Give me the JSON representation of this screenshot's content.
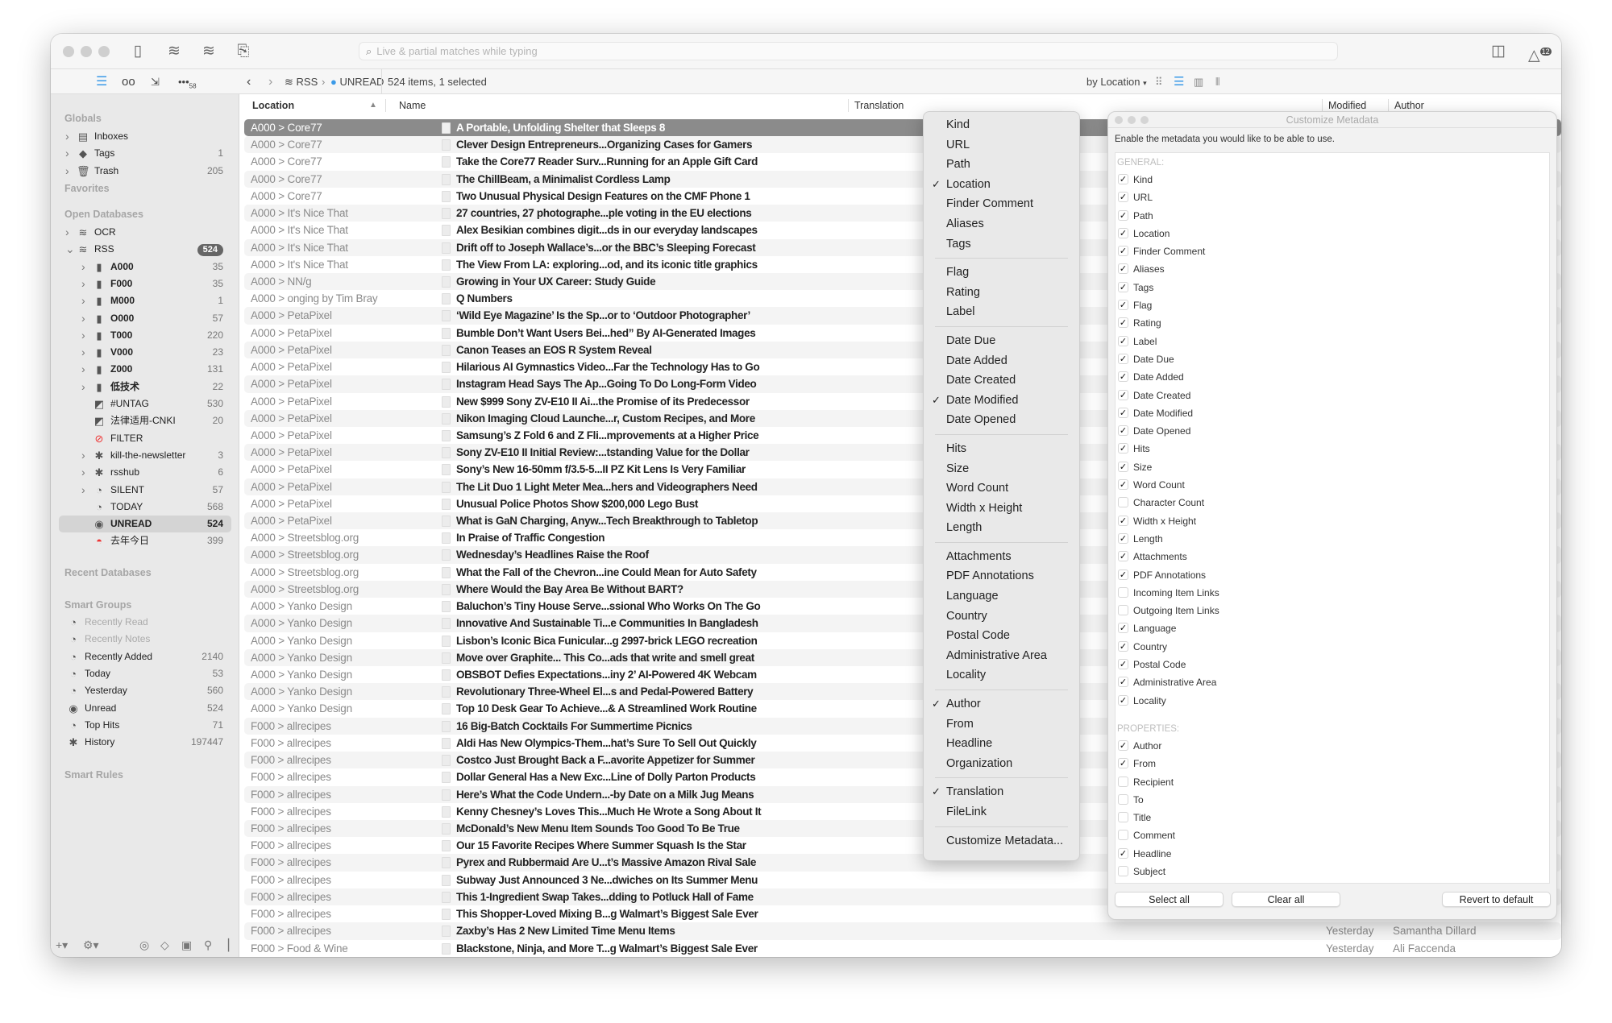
{
  "toolbar": {
    "search_placeholder": "Live & partial matches while typing",
    "notification_count": "12",
    "icons": [
      "sidebar-toggle-icon",
      "database-sync-icon",
      "database-verify-icon",
      "capture-icon",
      "inspector-toggle-icon",
      "activity-icon"
    ]
  },
  "navbar": {
    "sidebar_badge": "58",
    "crumbs": [
      "RSS",
      "UNREAD"
    ],
    "status": "524 items, 1 selected",
    "sort": "by Location",
    "accent": "#3a9ae8"
  },
  "sidebar": {
    "globals_label": "Globals",
    "globals": [
      {
        "label": "Inboxes",
        "count": "",
        "icon": "inbox-icon"
      },
      {
        "label": "Tags",
        "count": "1",
        "icon": "tag-icon"
      },
      {
        "label": "Trash",
        "count": "205",
        "icon": "trash-icon"
      }
    ],
    "favorites_label": "Favorites",
    "open_db_label": "Open Databases",
    "databases": [
      {
        "label": "OCR",
        "count": "",
        "icon": "database-icon",
        "chev": ">",
        "level": 0
      },
      {
        "label": "RSS",
        "count": "524",
        "icon": "database-icon",
        "chev": "v",
        "level": 0,
        "badge": true
      },
      {
        "label": "A000",
        "count": "35",
        "icon": "group-icon",
        "chev": ">",
        "level": 1,
        "bold": true
      },
      {
        "label": "F000",
        "count": "35",
        "icon": "group-icon",
        "chev": ">",
        "level": 1,
        "bold": true
      },
      {
        "label": "M000",
        "count": "1",
        "icon": "group-icon",
        "chev": ">",
        "level": 1,
        "bold": true
      },
      {
        "label": "O000",
        "count": "57",
        "icon": "group-icon",
        "chev": ">",
        "level": 1,
        "bold": true
      },
      {
        "label": "T000",
        "count": "220",
        "icon": "group-icon",
        "chev": ">",
        "level": 1,
        "bold": true
      },
      {
        "label": "V000",
        "count": "23",
        "icon": "group-icon",
        "chev": ">",
        "level": 1,
        "bold": true
      },
      {
        "label": "Z000",
        "count": "131",
        "icon": "group-icon",
        "chev": ">",
        "level": 1,
        "bold": true
      },
      {
        "label": "低技术",
        "count": "22",
        "icon": "group-icon",
        "chev": ">",
        "level": 1,
        "bold": true
      },
      {
        "label": "#UNTAG",
        "count": "530",
        "icon": "rss-feed-icon",
        "chev": "",
        "level": 1
      },
      {
        "label": "法律适用-CNKI",
        "count": "20",
        "icon": "rss-feed-icon",
        "chev": "",
        "level": 1
      },
      {
        "label": "FILTER",
        "count": "",
        "icon": "no-entry-icon",
        "chev": "",
        "level": 1
      },
      {
        "label": "kill-the-newsletter",
        "count": "3",
        "icon": "gear-icon",
        "chev": ">",
        "level": 1
      },
      {
        "label": "rsshub",
        "count": "6",
        "icon": "gear-icon",
        "chev": ">",
        "level": 1
      },
      {
        "label": "SILENT",
        "count": "57",
        "icon": "clock-icon",
        "chev": ">",
        "level": 1
      },
      {
        "label": "TODAY",
        "count": "568",
        "icon": "clock-icon",
        "chev": "",
        "level": 1
      },
      {
        "label": "UNREAD",
        "count": "524",
        "icon": "unread-icon",
        "chev": "",
        "level": 1,
        "selected": true
      },
      {
        "label": "去年今日",
        "count": "399",
        "icon": "sunset-icon",
        "chev": "",
        "level": 1
      }
    ],
    "recent_db_label": "Recent Databases",
    "smart_groups_label": "Smart Groups",
    "smart_groups": [
      {
        "label": "Recently Read",
        "count": "",
        "icon": "clock-icon",
        "dim": true
      },
      {
        "label": "Recently Notes",
        "count": "",
        "icon": "clock-icon",
        "dim": true
      },
      {
        "label": "Recently Added",
        "count": "2140",
        "icon": "clock-icon"
      },
      {
        "label": "Today",
        "count": "53",
        "icon": "clock-icon"
      },
      {
        "label": "Yesterday",
        "count": "560",
        "icon": "clock-icon"
      },
      {
        "label": "Unread",
        "count": "524",
        "icon": "unread-icon"
      },
      {
        "label": "Top Hits",
        "count": "71",
        "icon": "clock-icon"
      },
      {
        "label": "History",
        "count": "197447",
        "icon": "gear-icon"
      }
    ],
    "smart_rules_label": "Smart Rules"
  },
  "list": {
    "columns": {
      "location": "Location",
      "name": "Name",
      "translation": "Translation",
      "modified": "Modified",
      "author": "Author"
    },
    "rows": [
      {
        "loc": "A000 > Core77",
        "name": "A Portable, Unfolding Shelter that Sleeps 8",
        "selected": true
      },
      {
        "loc": "A000 > Core77",
        "name": "Clever Design Entrepreneurs...Organizing Cases for Gamers"
      },
      {
        "loc": "A000 > Core77",
        "name": "Take the Core77 Reader Surv...Running for an Apple Gift Card"
      },
      {
        "loc": "A000 > Core77",
        "name": "The ChillBeam, a Minimalist Cordless Lamp"
      },
      {
        "loc": "A000 > Core77",
        "name": "Two Unusual Physical Design Features on the CMF Phone 1"
      },
      {
        "loc": "A000 > It's Nice That",
        "name": "27 countries, 27 photographe...ple voting in the EU elections"
      },
      {
        "loc": "A000 > It's Nice That",
        "name": "Alex Besikian combines digit...ds in our everyday landscapes"
      },
      {
        "loc": "A000 > It's Nice That",
        "name": "Drift off to Joseph Wallace’s...or the BBC’s Sleeping Forecast"
      },
      {
        "loc": "A000 > It's Nice That",
        "name": "The View From LA: exploring...od, and its iconic title graphics"
      },
      {
        "loc": "A000 > NN/g",
        "name": "Growing in Your UX Career: Study Guide"
      },
      {
        "loc": "A000 > onging by Tim Bray",
        "name": "Q Numbers"
      },
      {
        "loc": "A000 > PetaPixel",
        "name": "‘Wild Eye Magazine’ Is the Sp...or to ‘Outdoor Photographer’"
      },
      {
        "loc": "A000 > PetaPixel",
        "name": "Bumble Don’t Want Users Bei...hed” By AI-Generated Images"
      },
      {
        "loc": "A000 > PetaPixel",
        "name": "Canon Teases an EOS R System Reveal"
      },
      {
        "loc": "A000 > PetaPixel",
        "name": "Hilarious AI Gymnastics Video...Far the Technology Has to Go"
      },
      {
        "loc": "A000 > PetaPixel",
        "name": "Instagram Head Says The Ap...Going To Do Long-Form Video"
      },
      {
        "loc": "A000 > PetaPixel",
        "name": "New $999 Sony ZV-E10 II Ai...the Promise of its Predecessor"
      },
      {
        "loc": "A000 > PetaPixel",
        "name": "Nikon Imaging Cloud Launche...r, Custom Recipes, and More"
      },
      {
        "loc": "A000 > PetaPixel",
        "name": "Samsung’s Z Fold 6 and Z Fli...mprovements at a Higher Price"
      },
      {
        "loc": "A000 > PetaPixel",
        "name": "Sony ZV-E10 II Initial Review:...tstanding Value for the Dollar"
      },
      {
        "loc": "A000 > PetaPixel",
        "name": "Sony’s New 16-50mm f/3.5-5...II PZ Kit Lens Is Very Familiar"
      },
      {
        "loc": "A000 > PetaPixel",
        "name": "The Lit Duo 1 Light Meter Mea...hers and Videographers Need"
      },
      {
        "loc": "A000 > PetaPixel",
        "name": "Unusual Police Photos Show $200,000 Lego Bust"
      },
      {
        "loc": "A000 > PetaPixel",
        "name": "What is GaN Charging, Anyw...Tech Breakthrough to Tabletop"
      },
      {
        "loc": "A000 > Streetsblog.org",
        "name": "In Praise of Traffic Congestion"
      },
      {
        "loc": "A000 > Streetsblog.org",
        "name": "Wednesday’s Headlines Raise the Roof"
      },
      {
        "loc": "A000 > Streetsblog.org",
        "name": "What the Fall of the Chevron...ine Could Mean for Auto Safety"
      },
      {
        "loc": "A000 > Streetsblog.org",
        "name": "Where Would the Bay Area Be Without BART?"
      },
      {
        "loc": "A000 > Yanko Design",
        "name": "Baluchon’s Tiny House Serve...ssional Who Works On The Go"
      },
      {
        "loc": "A000 > Yanko Design",
        "name": "Innovative And Sustainable Ti...e Communities In Bangladesh"
      },
      {
        "loc": "A000 > Yanko Design",
        "name": "Lisbon’s Iconic Bica Funicular...g 2997-brick LEGO recreation"
      },
      {
        "loc": "A000 > Yanko Design",
        "name": "Move over Graphite... This Co...ads that write and smell great"
      },
      {
        "loc": "A000 > Yanko Design",
        "name": "OBSBOT Defies Expectations...iny 2’ AI-Powered 4K Webcam"
      },
      {
        "loc": "A000 > Yanko Design",
        "name": "Revolutionary Three-Wheel El...s and Pedal-Powered Battery"
      },
      {
        "loc": "A000 > Yanko Design",
        "name": "Top 10 Desk Gear To Achieve...& A Streamlined Work Routine"
      },
      {
        "loc": "F000 > allrecipes",
        "name": "16 Big-Batch Cocktails For Summertime Picnics"
      },
      {
        "loc": "F000 > allrecipes",
        "name": "Aldi Has New Olympics-Them...hat’s Sure To Sell Out Quickly"
      },
      {
        "loc": "F000 > allrecipes",
        "name": "Costco Just Brought Back a F...avorite Appetizer for Summer"
      },
      {
        "loc": "F000 > allrecipes",
        "name": "Dollar General Has a New Exc...Line of Dolly Parton Products"
      },
      {
        "loc": "F000 > allrecipes",
        "name": "Here’s What the Code Undern...-by Date on a Milk Jug Means"
      },
      {
        "loc": "F000 > allrecipes",
        "name": "Kenny Chesney’s Loves This...Much He Wrote a Song About It"
      },
      {
        "loc": "F000 > allrecipes",
        "name": "McDonald’s New Menu Item Sounds Too Good To Be True"
      },
      {
        "loc": "F000 > allrecipes",
        "name": "Our 15 Favorite Recipes Where Summer Squash Is the Star"
      },
      {
        "loc": "F000 > allrecipes",
        "name": "Pyrex and Rubbermaid Are U...t’s Massive Amazon Rival Sale"
      },
      {
        "loc": "F000 > allrecipes",
        "name": "Subway Just Announced 3 Ne...dwiches on Its Summer Menu"
      },
      {
        "loc": "F000 > allrecipes",
        "name": "This 1-Ingredient Swap Takes...dding to Potluck Hall of Fame"
      },
      {
        "loc": "F000 > allrecipes",
        "name": "This Shopper-Loved Mixing B...g Walmart’s Biggest Sale Ever"
      },
      {
        "loc": "F000 > allrecipes",
        "name": "Zaxby’s Has 2 New Limited Time Menu Items",
        "modified": "Yesterday",
        "author": "Samantha Dillard"
      },
      {
        "loc": "F000 > Food & Wine",
        "name": "Blackstone, Ninja, and More T...g Walmart’s Biggest Sale Ever",
        "modified": "Yesterday",
        "author": "Ali Faccenda"
      }
    ]
  },
  "column_menu": {
    "groups": [
      [
        {
          "label": "Kind"
        },
        {
          "label": "URL"
        },
        {
          "label": "Path"
        },
        {
          "label": "Location",
          "checked": true
        },
        {
          "label": "Finder Comment"
        },
        {
          "label": "Aliases"
        },
        {
          "label": "Tags"
        }
      ],
      [
        {
          "label": "Flag"
        },
        {
          "label": "Rating"
        },
        {
          "label": "Label"
        }
      ],
      [
        {
          "label": "Date Due"
        },
        {
          "label": "Date Added"
        },
        {
          "label": "Date Created"
        },
        {
          "label": "Date Modified",
          "checked": true
        },
        {
          "label": "Date Opened"
        }
      ],
      [
        {
          "label": "Hits"
        },
        {
          "label": "Size"
        },
        {
          "label": "Word Count"
        },
        {
          "label": "Width x Height"
        },
        {
          "label": "Length"
        }
      ],
      [
        {
          "label": "Attachments"
        },
        {
          "label": "PDF Annotations"
        },
        {
          "label": "Language"
        },
        {
          "label": "Country"
        },
        {
          "label": "Postal Code"
        },
        {
          "label": "Administrative Area"
        },
        {
          "label": "Locality"
        }
      ],
      [
        {
          "label": "Author",
          "checked": true
        },
        {
          "label": "From"
        },
        {
          "label": "Headline"
        },
        {
          "label": "Organization"
        }
      ],
      [
        {
          "label": "Translation",
          "checked": true
        },
        {
          "label": "FileLink"
        }
      ],
      [
        {
          "label": "Customize Metadata..."
        }
      ]
    ]
  },
  "customize_panel": {
    "title": "Customize Metadata",
    "description": "Enable the metadata you would like to be able to use.",
    "sections": [
      {
        "header": "GENERAL:",
        "items": [
          {
            "label": "Kind",
            "checked": true
          },
          {
            "label": "URL",
            "checked": true
          },
          {
            "label": "Path",
            "checked": true
          },
          {
            "label": "Location",
            "checked": true
          },
          {
            "label": "Finder Comment",
            "checked": true
          },
          {
            "label": "Aliases",
            "checked": true
          },
          {
            "label": "Tags",
            "checked": true
          },
          {
            "label": "Flag",
            "checked": true
          },
          {
            "label": "Rating",
            "checked": true
          },
          {
            "label": "Label",
            "checked": true
          },
          {
            "label": "Date Due",
            "checked": true
          },
          {
            "label": "Date Added",
            "checked": true
          },
          {
            "label": "Date Created",
            "checked": true
          },
          {
            "label": "Date Modified",
            "checked": true
          },
          {
            "label": "Date Opened",
            "checked": true
          },
          {
            "label": "Hits",
            "checked": true
          },
          {
            "label": "Size",
            "checked": true
          },
          {
            "label": "Word Count",
            "checked": true
          },
          {
            "label": "Character Count",
            "checked": false
          },
          {
            "label": "Width x Height",
            "checked": true
          },
          {
            "label": "Length",
            "checked": true
          },
          {
            "label": "Attachments",
            "checked": true
          },
          {
            "label": "PDF Annotations",
            "checked": true
          },
          {
            "label": "Incoming Item Links",
            "checked": false
          },
          {
            "label": "Outgoing Item Links",
            "checked": false
          },
          {
            "label": "Language",
            "checked": true
          },
          {
            "label": "Country",
            "checked": true
          },
          {
            "label": "Postal Code",
            "checked": true
          },
          {
            "label": "Administrative Area",
            "checked": true
          },
          {
            "label": "Locality",
            "checked": true
          }
        ]
      },
      {
        "header": "PROPERTIES:",
        "items": [
          {
            "label": "Author",
            "checked": true
          },
          {
            "label": "From",
            "checked": true
          },
          {
            "label": "Recipient",
            "checked": false
          },
          {
            "label": "To",
            "checked": false
          },
          {
            "label": "Title",
            "checked": false
          },
          {
            "label": "Comment",
            "checked": false
          },
          {
            "label": "Headline",
            "checked": true
          },
          {
            "label": "Subject",
            "checked": false
          }
        ]
      }
    ],
    "buttons": {
      "select_all": "Select all",
      "clear_all": "Clear all",
      "revert": "Revert to default"
    }
  }
}
